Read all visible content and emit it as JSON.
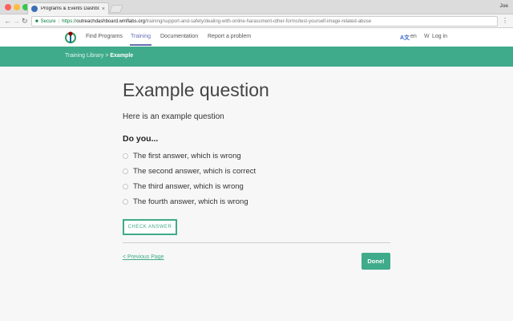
{
  "browser": {
    "tab_title": "Programs & Events Dashboard",
    "tab_close": "×",
    "user": "Joe",
    "secure_label": "Secure",
    "url_proto": "https://",
    "url_host": "outreachdashboard.wmflabs.org",
    "url_path": "/training/support-and-safety/dealing-with-online-harassment-other-forms/test-yourself-image-related-abuse"
  },
  "nav": {
    "items": [
      "Find Programs",
      "Training",
      "Documentation",
      "Report a problem"
    ],
    "active": "Training",
    "language": "en",
    "login": "Log in"
  },
  "breadcrumb": {
    "parent": "Training Library",
    "separator": ">",
    "current": "Example"
  },
  "question": {
    "title": "Example question",
    "text": "Here is an example question",
    "prompt": "Do you...",
    "answers": [
      "The first answer, which is wrong",
      "The second answer, which is correct",
      "The third answer, which is wrong",
      "The fourth answer, which is wrong"
    ],
    "check_label": "CHECK ANSWER"
  },
  "footer": {
    "prev_label": "< Previous Page",
    "done_label": "Done!"
  },
  "colors": {
    "accent": "#3fab8a",
    "nav_active": "#676eb4"
  },
  "icons": {
    "logo": "wikimedia-logo-icon",
    "language": "translate-icon",
    "login": "wikipedia-w-icon",
    "lock": "lock-icon"
  }
}
